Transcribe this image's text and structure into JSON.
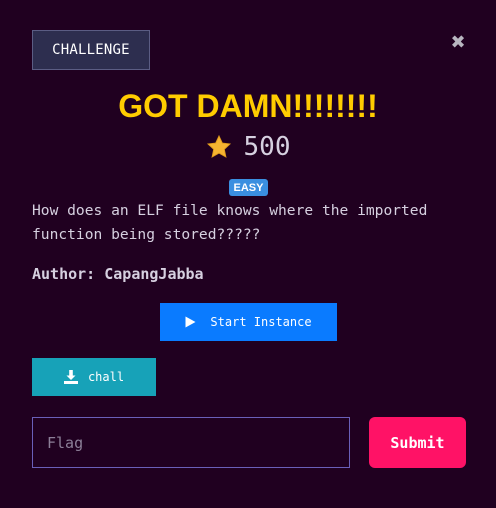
{
  "tab": {
    "label": "CHALLENGE"
  },
  "close": {
    "glyph": "✖",
    "icon": "close-icon"
  },
  "challenge": {
    "title": "GOT DAMN!!!!!!!!",
    "points": "500",
    "difficulty": "EASY",
    "description": "How does an ELF file knows where the imported function being stored?????",
    "author": "Author: CapangJabba"
  },
  "buttons": {
    "start_instance": "Start Instance",
    "download": "chall",
    "submit": "Submit"
  },
  "flag_input": {
    "value": "",
    "placeholder": "Flag"
  },
  "colors": {
    "background": "#200020",
    "title": "#ffcc00",
    "start": "#0a7bff",
    "download": "#17a2b8",
    "submit": "#ff1266",
    "badge": "#3a8fe0"
  }
}
